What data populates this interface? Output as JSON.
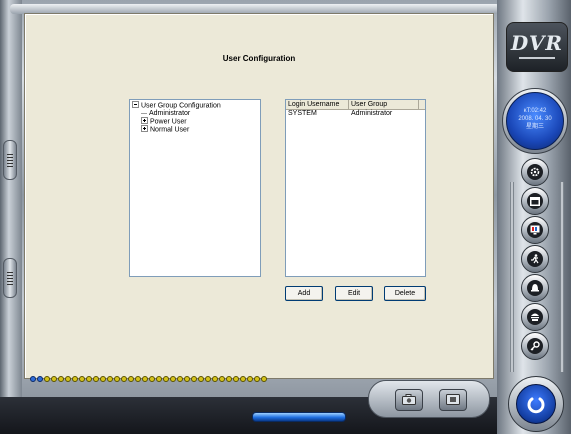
{
  "window": {
    "title": "User Configuration"
  },
  "logo": {
    "text": "DVR"
  },
  "clock": {
    "time": "ĸT:02:42",
    "date": "2008. 04. 30",
    "weekday": "星期三"
  },
  "tree": {
    "root": "User Group Configuration",
    "items": [
      {
        "label": "Administrator",
        "expandable": false
      },
      {
        "label": "Power User",
        "expandable": true
      },
      {
        "label": "Normal User",
        "expandable": true
      }
    ]
  },
  "user_list": {
    "columns": [
      "Login Username",
      "User Group"
    ],
    "rows": [
      [
        "SYSTEM",
        "Administrator"
      ]
    ]
  },
  "buttons": {
    "add": "Add",
    "edit": "Edit",
    "delete": "Delete"
  },
  "sidebar_buttons": [
    {
      "icon": "gear-icon"
    },
    {
      "icon": "calendar-icon"
    },
    {
      "icon": "monitor-icon"
    },
    {
      "icon": "running-man-icon"
    },
    {
      "icon": "bell-icon"
    },
    {
      "icon": "dome-camera-icon"
    },
    {
      "icon": "key-icon"
    }
  ],
  "bottom_buttons": [
    {
      "icon": "snapshot-icon"
    },
    {
      "icon": "record-icon"
    }
  ],
  "colors": {
    "panel": "#ece9d8",
    "accent_blue": "#1f6fe0",
    "dot_yellow": "#d4c21a"
  }
}
